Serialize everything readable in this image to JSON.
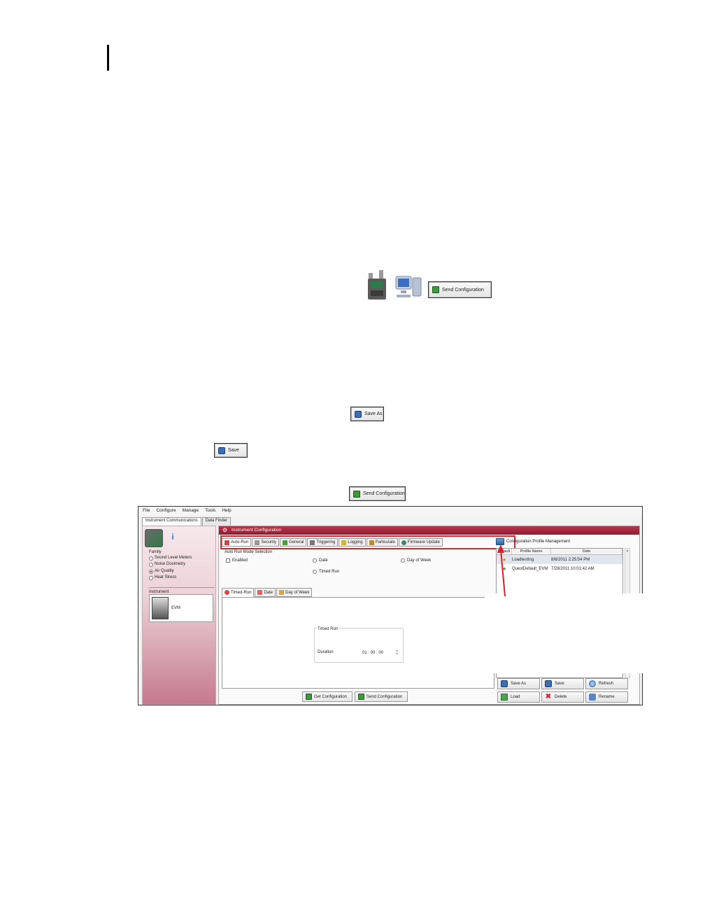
{
  "doc": {
    "send_configuration_label": "Send Configuration",
    "save_as_label": "Save As",
    "save_label": "Save"
  },
  "app": {
    "menu": [
      "File",
      "Configure",
      "Manage",
      "Tools",
      "Help"
    ],
    "top_tabs": [
      "Instrument Communications",
      "Data Finder"
    ],
    "family": {
      "label": "Family",
      "options": [
        "Sound Level Meters",
        "Noise Dosimetry",
        "Air Quality",
        "Heat Stress"
      ],
      "selected": "Air Quality"
    },
    "instrument": {
      "label": "Instrument",
      "name": "EVM"
    },
    "config": {
      "title": "Instrument Configuration",
      "tabs": [
        "Auto-Run",
        "Security",
        "General",
        "Triggering",
        "Logging",
        "Particulate",
        "Firmware Update"
      ],
      "active_tab": "Auto-Run",
      "auto_run_label": "Auto Run Mode Selection",
      "enabled_label": "Enabled",
      "mode_options": [
        "Date",
        "Day of Week",
        "Timed Run"
      ],
      "sub_tabs": [
        "Timed-Run",
        "Date",
        "Day of Week"
      ],
      "timed_run_group": "Timed Run",
      "duration_label": "Duration",
      "duration_value": "01 : 00 : 00",
      "get_button": "Get Configuration",
      "send_button": "Send Configuration"
    },
    "profiles": {
      "title": "Configuration Profile Management",
      "columns": [
        "Default",
        "Profile Name",
        "Date"
      ],
      "rows": [
        {
          "name": "Loadtesting",
          "date": "8/8/2011 2:25:54 PM"
        },
        {
          "name": "QuestDefault_EVM",
          "date": "7/28/2011 10:01:42 AM"
        }
      ],
      "buttons": [
        "Save As",
        "Save",
        "Refresh",
        "Load",
        "Delete",
        "Rename"
      ]
    }
  },
  "colors": {
    "accent": "#9e2238",
    "highlight": "#e0252f"
  }
}
